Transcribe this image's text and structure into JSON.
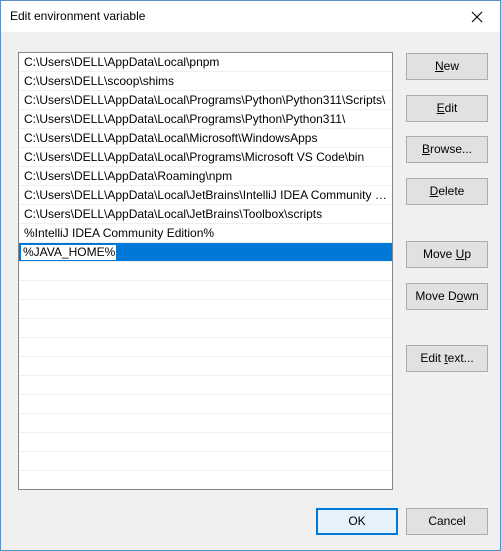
{
  "window": {
    "title": "Edit environment variable",
    "close_icon": "close-icon"
  },
  "list": {
    "items": [
      "C:\\Users\\DELL\\AppData\\Local\\pnpm",
      "C:\\Users\\DELL\\scoop\\shims",
      "C:\\Users\\DELL\\AppData\\Local\\Programs\\Python\\Python311\\Scripts\\",
      "C:\\Users\\DELL\\AppData\\Local\\Programs\\Python\\Python311\\",
      "C:\\Users\\DELL\\AppData\\Local\\Microsoft\\WindowsApps",
      "C:\\Users\\DELL\\AppData\\Local\\Programs\\Microsoft VS Code\\bin",
      "C:\\Users\\DELL\\AppData\\Roaming\\npm",
      "C:\\Users\\DELL\\AppData\\Local\\JetBrains\\IntelliJ IDEA Community Edi...",
      "C:\\Users\\DELL\\AppData\\Local\\JetBrains\\Toolbox\\scripts",
      "%IntelliJ IDEA Community Edition%"
    ],
    "editing_value": "%JAVA_HOME%"
  },
  "buttons": {
    "new": {
      "pre": "",
      "u": "N",
      "post": "ew"
    },
    "edit": {
      "pre": "",
      "u": "E",
      "post": "dit"
    },
    "browse": {
      "pre": "",
      "u": "B",
      "post": "rowse..."
    },
    "delete": {
      "pre": "",
      "u": "D",
      "post": "elete"
    },
    "move_up": {
      "pre": "Move ",
      "u": "U",
      "post": "p"
    },
    "move_down": {
      "pre": "Move D",
      "u": "o",
      "post": "wn"
    },
    "edit_text": {
      "pre": "Edit ",
      "u": "t",
      "post": "ext..."
    },
    "ok": "OK",
    "cancel": "Cancel"
  },
  "colors": {
    "selection": "#0078d7",
    "border": "#828790"
  }
}
